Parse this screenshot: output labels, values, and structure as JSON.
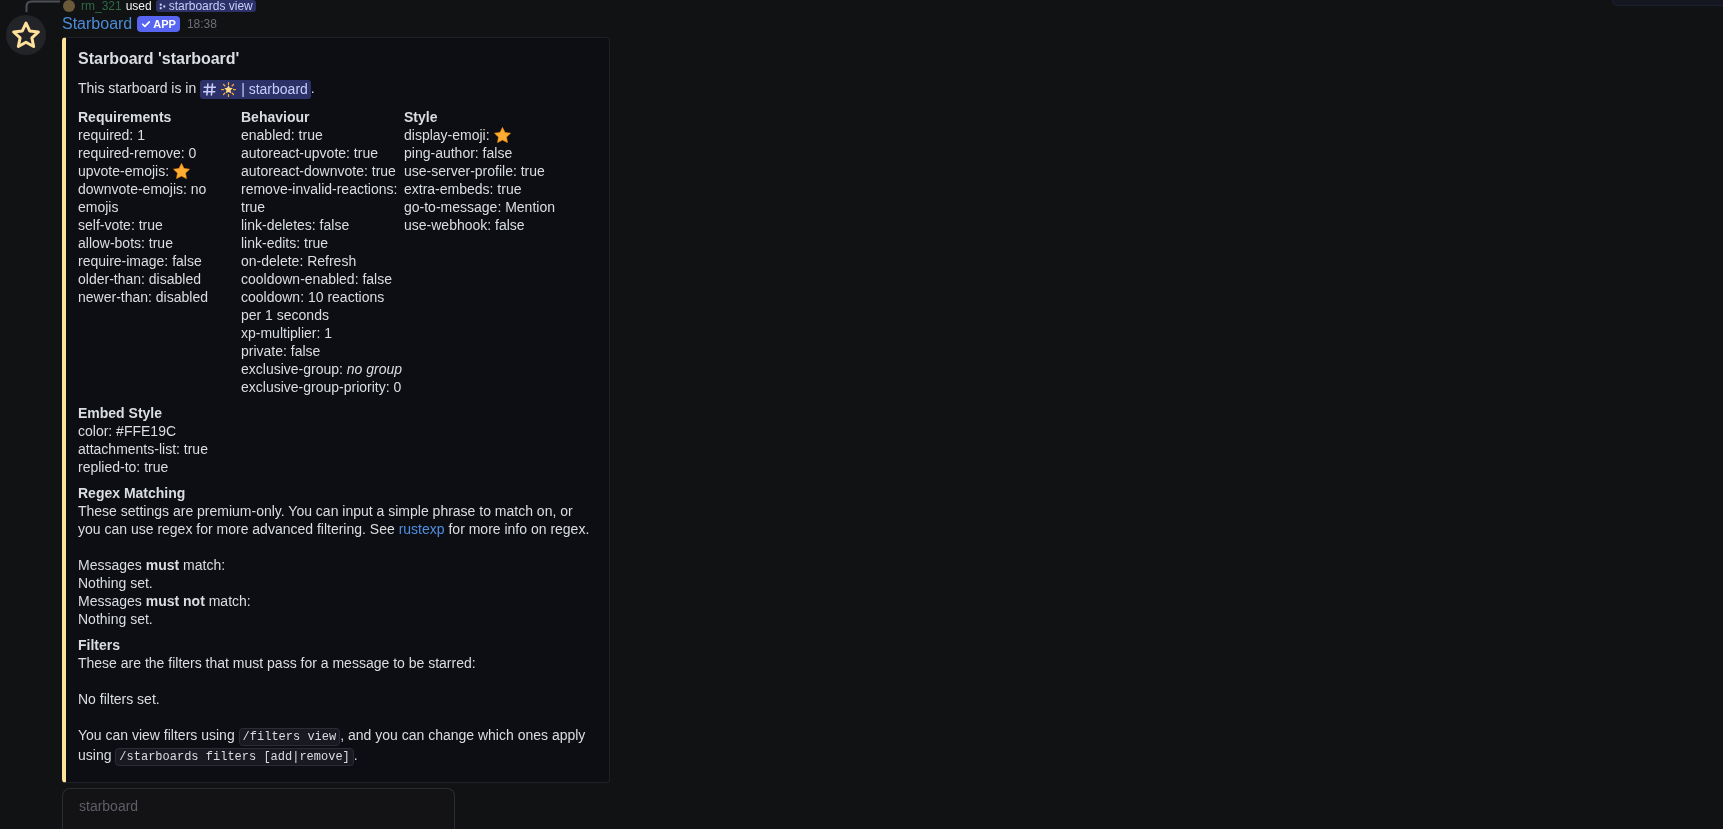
{
  "reply": {
    "username": "rm_321",
    "verb": "used",
    "command": "starboards view"
  },
  "message": {
    "author": "Starboard",
    "badge": "APP",
    "time": "18:38"
  },
  "embed": {
    "title": "Starboard 'starboard'",
    "description": [
      {
        "kind": "text",
        "text": "This starboard is in "
      },
      {
        "kind": "channel",
        "text": "| starboard"
      },
      {
        "kind": "text",
        "text": "."
      }
    ],
    "fields": [
      {
        "kind": "inline",
        "name": "Requirements",
        "paragraphs": [
          [
            {
              "kind": "text",
              "text": "required: 1"
            },
            {
              "kind": "text",
              "text": "required-remove: 0"
            },
            {
              "kind": "emoji",
              "text": "upvote-emojis:"
            },
            {
              "kind": "text",
              "text": "downvote-emojis: no emojis"
            },
            {
              "kind": "text",
              "text": "self-vote: true"
            },
            {
              "kind": "text",
              "text": "allow-bots: true"
            },
            {
              "kind": "text",
              "text": "require-image: false"
            },
            {
              "kind": "text",
              "text": "older-than: disabled"
            },
            {
              "kind": "text",
              "text": "newer-than: disabled"
            }
          ]
        ]
      },
      {
        "kind": "inline",
        "name": "Behaviour",
        "paragraphs": [
          [
            {
              "kind": "text",
              "text": "enabled: true"
            },
            {
              "kind": "text",
              "text": "autoreact-upvote: true"
            },
            {
              "kind": "text",
              "text": "autoreact-downvote: true"
            },
            {
              "kind": "text",
              "text": "remove-invalid-reactions: true"
            },
            {
              "kind": "text",
              "text": "link-deletes: false"
            },
            {
              "kind": "text",
              "text": "link-edits: true"
            },
            {
              "kind": "text",
              "text": "on-delete: Refresh"
            },
            {
              "kind": "text",
              "text": "cooldown-enabled: false"
            },
            {
              "kind": "text",
              "text": "cooldown: 10 reactions per 1 seconds"
            },
            {
              "kind": "text",
              "text": "xp-multiplier: 1"
            },
            {
              "kind": "text",
              "text": "private: false"
            },
            {
              "kind": "text",
              "text": "exclusive-group: *no group*"
            },
            {
              "kind": "text",
              "text": "exclusive-group-priority: 0"
            }
          ]
        ]
      },
      {
        "kind": "inline",
        "name": "Style",
        "paragraphs": [
          [
            {
              "kind": "emoji",
              "text": "display-emoji:"
            },
            {
              "kind": "text",
              "text": "ping-author: false"
            },
            {
              "kind": "text",
              "text": "use-server-profile: true"
            },
            {
              "kind": "text",
              "text": "extra-embeds: true"
            },
            {
              "kind": "text",
              "text": "go-to-message: Mention"
            },
            {
              "kind": "text",
              "text": "use-webhook: false"
            }
          ]
        ]
      },
      {
        "kind": "full",
        "name": "Embed Style",
        "paragraphs": [
          [
            {
              "kind": "text",
              "text": "color: #FFE19C"
            },
            {
              "kind": "text",
              "text": "attachments-list: true"
            },
            {
              "kind": "text",
              "text": "replied-to: true"
            }
          ]
        ]
      },
      {
        "kind": "full",
        "name": "Regex Matching",
        "paragraphs": [
          [
            {
              "kind": "segments",
              "segments": [
                {
                  "kind": "text",
                  "text": "These settings are premium-only. You can input a simple phrase to match on, or you can use regex for more advanced filtering. See "
                },
                {
                  "kind": "link",
                  "text": "rustexp"
                },
                {
                  "kind": "text",
                  "text": " for more info on regex."
                }
              ]
            }
          ],
          [
            {
              "kind": "text",
              "text": "Messages **must** match:"
            },
            {
              "kind": "text",
              "text": "Nothing set."
            },
            {
              "kind": "text",
              "text": "Messages **must not** match:"
            },
            {
              "kind": "text",
              "text": "Nothing set."
            }
          ]
        ]
      },
      {
        "kind": "full",
        "name": "Filters",
        "paragraphs": [
          [
            {
              "kind": "text",
              "text": "These are the filters that must pass for a message to be starred:"
            }
          ],
          [
            {
              "kind": "text",
              "text": "No filters set."
            }
          ],
          [
            {
              "kind": "segments",
              "segments": [
                {
                  "kind": "text",
                  "text": "You can view filters using "
                },
                {
                  "kind": "code",
                  "text": "/filters view"
                },
                {
                  "kind": "text",
                  "text": ", and you can change which ones apply using "
                },
                {
                  "kind": "code",
                  "text": "/starboards filters [add|remove]"
                },
                {
                  "kind": "text",
                  "text": "."
                }
              ]
            }
          ]
        ]
      }
    ]
  },
  "partial_card": {
    "text": "starboard"
  }
}
